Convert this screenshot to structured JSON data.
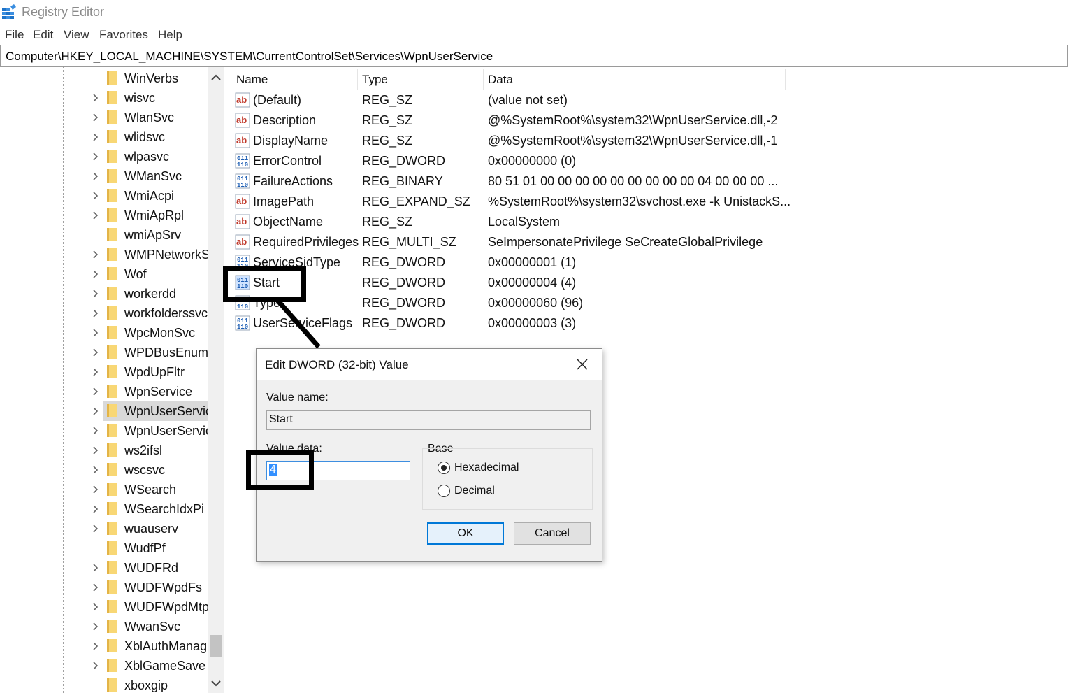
{
  "window": {
    "title": "Registry Editor"
  },
  "menu": [
    "File",
    "Edit",
    "View",
    "Favorites",
    "Help"
  ],
  "address": "Computer\\HKEY_LOCAL_MACHINE\\SYSTEM\\CurrentControlSet\\Services\\WpnUserService",
  "tree": {
    "items": [
      {
        "label": "WinVerbs",
        "expandable": false
      },
      {
        "label": "wisvc",
        "expandable": true
      },
      {
        "label": "WlanSvc",
        "expandable": true
      },
      {
        "label": "wlidsvc",
        "expandable": true
      },
      {
        "label": "wlpasvc",
        "expandable": true
      },
      {
        "label": "WManSvc",
        "expandable": true
      },
      {
        "label": "WmiAcpi",
        "expandable": true
      },
      {
        "label": "WmiApRpl",
        "expandable": true
      },
      {
        "label": "wmiApSrv",
        "expandable": false
      },
      {
        "label": "WMPNetworkS",
        "expandable": true
      },
      {
        "label": "Wof",
        "expandable": true
      },
      {
        "label": "workerdd",
        "expandable": true
      },
      {
        "label": "workfolderssvc",
        "expandable": true
      },
      {
        "label": "WpcMonSvc",
        "expandable": true
      },
      {
        "label": "WPDBusEnum",
        "expandable": true
      },
      {
        "label": "WpdUpFltr",
        "expandable": true
      },
      {
        "label": "WpnService",
        "expandable": true
      },
      {
        "label": "WpnUserServic",
        "expandable": true,
        "selected": true
      },
      {
        "label": "WpnUserServic",
        "expandable": true
      },
      {
        "label": "ws2ifsl",
        "expandable": true
      },
      {
        "label": "wscsvc",
        "expandable": true
      },
      {
        "label": "WSearch",
        "expandable": true
      },
      {
        "label": "WSearchIdxPi",
        "expandable": true
      },
      {
        "label": "wuauserv",
        "expandable": true
      },
      {
        "label": "WudfPf",
        "expandable": false
      },
      {
        "label": "WUDFRd",
        "expandable": true
      },
      {
        "label": "WUDFWpdFs",
        "expandable": true
      },
      {
        "label": "WUDFWpdMtp",
        "expandable": true
      },
      {
        "label": "WwanSvc",
        "expandable": true
      },
      {
        "label": "XblAuthManag",
        "expandable": true
      },
      {
        "label": "XblGameSave",
        "expandable": true
      },
      {
        "label": "xboxgip",
        "expandable": false
      }
    ]
  },
  "values": {
    "columns": {
      "name": "Name",
      "type": "Type",
      "data": "Data"
    },
    "rows": [
      {
        "name": "(Default)",
        "type": "REG_SZ",
        "data": "(value not set)",
        "icon": "string-value-icon"
      },
      {
        "name": "Description",
        "type": "REG_SZ",
        "data": "@%SystemRoot%\\system32\\WpnUserService.dll,-2",
        "icon": "string-value-icon"
      },
      {
        "name": "DisplayName",
        "type": "REG_SZ",
        "data": "@%SystemRoot%\\system32\\WpnUserService.dll,-1",
        "icon": "string-value-icon"
      },
      {
        "name": "ErrorControl",
        "type": "REG_DWORD",
        "data": "0x00000000 (0)",
        "icon": "binary-value-icon"
      },
      {
        "name": "FailureActions",
        "type": "REG_BINARY",
        "data": "80 51 01 00 00 00 00 00 00 00 00 00 04 00 00 00 ...",
        "icon": "binary-value-icon"
      },
      {
        "name": "ImagePath",
        "type": "REG_EXPAND_SZ",
        "data": "%SystemRoot%\\system32\\svchost.exe -k UnistackS...",
        "icon": "string-value-icon"
      },
      {
        "name": "ObjectName",
        "type": "REG_SZ",
        "data": "LocalSystem",
        "icon": "string-value-icon"
      },
      {
        "name": "RequiredPrivileges",
        "type": "REG_MULTI_SZ",
        "data": "SeImpersonatePrivilege SeCreateGlobalPrivilege",
        "icon": "string-value-icon"
      },
      {
        "name": "ServiceSidType",
        "type": "REG_DWORD",
        "data": "0x00000001 (1)",
        "icon": "binary-value-icon"
      },
      {
        "name": "Start",
        "type": "REG_DWORD",
        "data": "0x00000004 (4)",
        "icon": "binary-value-icon",
        "selected": true
      },
      {
        "name": "Type",
        "type": "REG_DWORD",
        "data": "0x00000060 (96)",
        "icon": "binary-value-icon"
      },
      {
        "name": "UserServiceFlags",
        "type": "REG_DWORD",
        "data": "0x00000003 (3)",
        "icon": "binary-value-icon"
      }
    ]
  },
  "dialog": {
    "title": "Edit DWORD (32-bit) Value",
    "value_name_label": "Value name:",
    "value_name": "Start",
    "value_data_label": "Value data:",
    "value_data": "4",
    "base_label": "Base",
    "base_options": [
      "Hexadecimal",
      "Decimal"
    ],
    "base_selected": "Hexadecimal",
    "ok_label": "OK",
    "cancel_label": "Cancel"
  },
  "colors": {
    "selection_blue": "#3390ff",
    "accent": "#0078d7",
    "folder_yellow": "#f8d775",
    "tree_selected": "#d9d9d9"
  }
}
